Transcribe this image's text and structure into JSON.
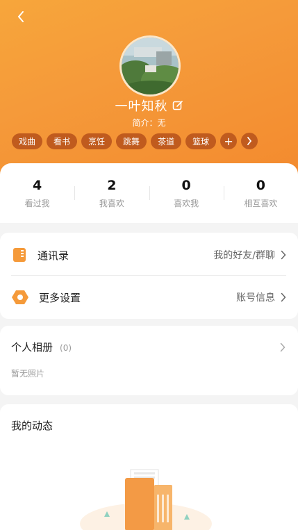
{
  "profile": {
    "name": "一叶知秋",
    "intro": "简介：无",
    "tags": [
      "戏曲",
      "看书",
      "烹饪",
      "跳舞",
      "茶道",
      "篮球"
    ]
  },
  "stats": [
    {
      "num": "4",
      "label": "看过我"
    },
    {
      "num": "2",
      "label": "我喜欢"
    },
    {
      "num": "0",
      "label": "喜欢我"
    },
    {
      "num": "0",
      "label": "相互喜欢"
    }
  ],
  "menu": {
    "contacts": {
      "title": "通讯录",
      "right": "我的好友/群聊"
    },
    "settings": {
      "title": "更多设置",
      "right": "账号信息"
    }
  },
  "album": {
    "title": "个人相册",
    "count": "(0)",
    "empty": "暂无照片"
  },
  "feed": {
    "title": "我的动态"
  },
  "colors": {
    "accent": "#f59a3a",
    "tag_bg": "#c05b1e"
  }
}
